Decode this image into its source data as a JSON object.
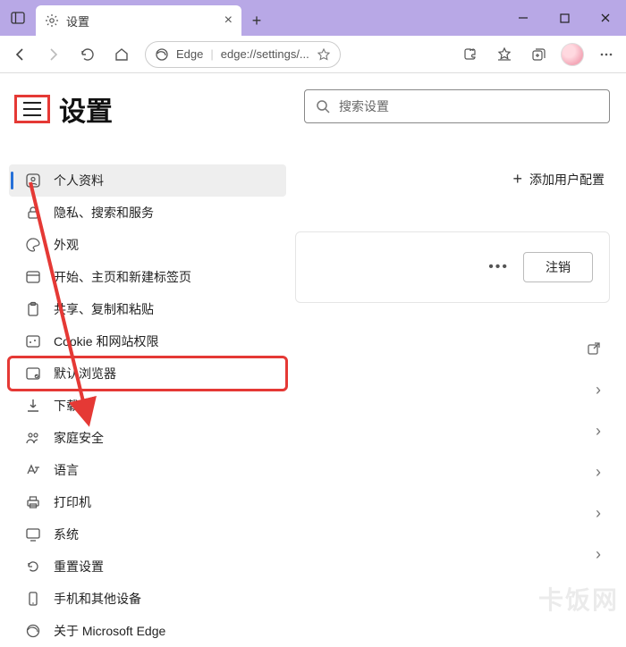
{
  "window": {
    "tab_title": "设置",
    "newtab_tooltip": "+"
  },
  "toolbar": {
    "edge_label": "Edge",
    "url": "edge://settings/..."
  },
  "page": {
    "title": "设置"
  },
  "sidebar": {
    "items": [
      {
        "label": "个人资料"
      },
      {
        "label": "隐私、搜索和服务"
      },
      {
        "label": "外观"
      },
      {
        "label": "开始、主页和新建标签页"
      },
      {
        "label": "共享、复制和粘贴"
      },
      {
        "label": "Cookie 和网站权限"
      },
      {
        "label": "默认浏览器"
      },
      {
        "label": "下载"
      },
      {
        "label": "家庭安全"
      },
      {
        "label": "语言"
      },
      {
        "label": "打印机"
      },
      {
        "label": "系统"
      },
      {
        "label": "重置设置"
      },
      {
        "label": "手机和其他设备"
      },
      {
        "label": "关于 Microsoft Edge"
      }
    ]
  },
  "main": {
    "search_placeholder": "搜索设置",
    "add_profile": "添加用户配置",
    "logout": "注销"
  },
  "watermark": "卡饭网"
}
